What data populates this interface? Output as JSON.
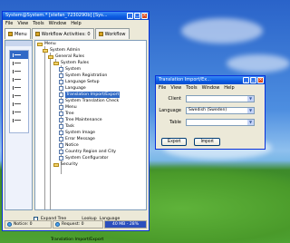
{
  "main_window": {
    "title": "System@System.* [stefan_7230290b] [Sys...",
    "menu": [
      "File",
      "View",
      "Tools",
      "Window",
      "Help"
    ],
    "tabs": [
      {
        "label": "Menu"
      },
      {
        "label": "Workflow Activities: 0"
      },
      {
        "label": "Workflow"
      }
    ],
    "tree": {
      "items": [
        {
          "label": "Menu",
          "type": "folder"
        },
        {
          "label": "System Admin",
          "type": "folder"
        },
        {
          "label": "General Rules",
          "type": "folder"
        },
        {
          "label": "System Rules",
          "type": "folder"
        },
        {
          "label": "System",
          "type": "doc"
        },
        {
          "label": "System Registration",
          "type": "doc"
        },
        {
          "label": "Language Setup",
          "type": "doc"
        },
        {
          "label": "Language",
          "type": "doc"
        },
        {
          "label": "Translation Import/Export",
          "type": "doc",
          "selected": true
        },
        {
          "label": "System Translation Check",
          "type": "doc"
        },
        {
          "label": "Menu",
          "type": "doc"
        },
        {
          "label": "Tree",
          "type": "doc"
        },
        {
          "label": "Tree Maintenance",
          "type": "doc"
        },
        {
          "label": "Task",
          "type": "doc"
        },
        {
          "label": "System Image",
          "type": "doc"
        },
        {
          "label": "Error Message",
          "type": "doc"
        },
        {
          "label": "Notice",
          "type": "doc"
        },
        {
          "label": "Country Region and City",
          "type": "doc"
        },
        {
          "label": "System Configurator",
          "type": "doc"
        },
        {
          "label": "Security",
          "type": "folder"
        }
      ]
    },
    "expand_tree_label": "Expand Tree",
    "lookup_label": "Lookup",
    "lookup_value": "Language",
    "status": {
      "notice": "Notice: 0",
      "request": "Request: 0",
      "memory": "40 MB - 28%"
    },
    "footer_label": "Translation Import/Export"
  },
  "dialog": {
    "title": "Translation Import/Ex...",
    "menu": [
      "File",
      "View",
      "Tools",
      "Window",
      "Help"
    ],
    "fields": {
      "client_label": "Client",
      "client_value": "",
      "language_label": "Language",
      "language_value": "Swedish (Sweden)",
      "table_label": "Table",
      "table_value": ""
    },
    "export_label": "Export",
    "import_label": "Import"
  },
  "colors": {
    "titlebar": "#0b5ae0",
    "selection": "#316ac5",
    "window_bg": "#ece9d8"
  }
}
